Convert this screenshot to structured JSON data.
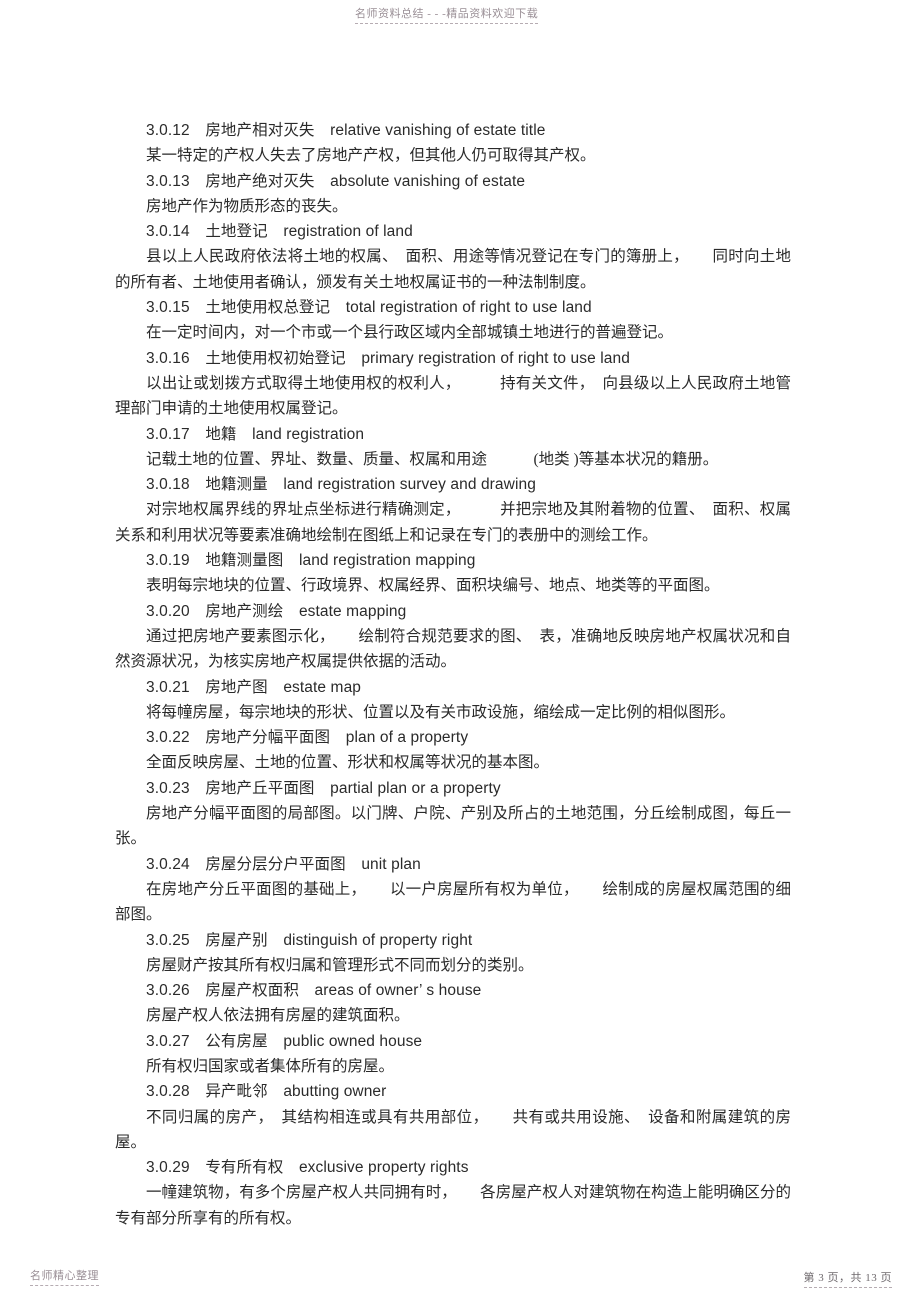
{
  "watermarks": {
    "top": "名师资料总结 - - -精品资料欢迎下载",
    "bottom_left": "名师精心整理",
    "page_footer": "第 3 页，共 13 页"
  },
  "entries": [
    {
      "number": "3.0.12",
      "term_cn": "房地产相对灭失",
      "term_en": "relative vanishing of estate title",
      "definition": "某一特定的产权人失去了房地产产权，但其他人仍可取得其产权。"
    },
    {
      "number": "3.0.13",
      "term_cn": "房地产绝对灭失",
      "term_en": "absolute vanishing of estate",
      "definition": "房地产作为物质形态的丧失。"
    },
    {
      "number": "3.0.14",
      "term_cn": "土地登记",
      "term_en": "registration of land",
      "definition": "县以上人民政府依法将土地的权属、　面积、用途等情况登记在专门的簿册上，　　同时向土地的所有者、土地使用者确认，颁发有关土地权属证书的一种法制制度。"
    },
    {
      "number": "3.0.15",
      "term_cn": "土地使用权总登记",
      "term_en": "total registration of right to use land",
      "definition": "在一定时间内，对一个市或一个县行政区域内全部城镇土地进行的普遍登记。"
    },
    {
      "number": "3.0.16",
      "term_cn": "土地使用权初始登记",
      "term_en": "primary registration of right to use land",
      "definition": "以出让或划拨方式取得土地使用权的权利人，　　　持有关文件，　向县级以上人民政府土地管理部门申请的土地使用权属登记。"
    },
    {
      "number": "3.0.17",
      "term_cn": "地籍",
      "term_en": "land registration",
      "definition": "记载土地的位置、界址、数量、质量、权属和用途　　　(地类 )等基本状况的籍册。"
    },
    {
      "number": "3.0.18",
      "term_cn": "地籍测量",
      "term_en": "land registration survey and drawing",
      "definition": "对宗地权属界线的界址点坐标进行精确测定，　　　并把宗地及其附着物的位置、　面积、权属关系和利用状况等要素准确地绘制在图纸上和记录在专门的表册中的测绘工作。"
    },
    {
      "number": "3.0.19",
      "term_cn": "地籍测量图",
      "term_en": "land registration mapping",
      "definition": "表明每宗地块的位置、行政境界、权属经界、面积块编号、地点、地类等的平面图。"
    },
    {
      "number": "3.0.20",
      "term_cn": "房地产测绘",
      "term_en": "estate mapping",
      "definition": "通过把房地产要素图示化，　　绘制符合规范要求的图、　表，准确地反映房地产权属状况和自然资源状况，为核实房地产权属提供依据的活动。"
    },
    {
      "number": "3.0.21",
      "term_cn": "房地产图",
      "term_en": "estate map",
      "definition": "将每幢房屋，每宗地块的形状、位置以及有关市政设施，缩绘成一定比例的相似图形。"
    },
    {
      "number": "3.0.22",
      "term_cn": "房地产分幅平面图",
      "term_en": "plan of a property",
      "definition": "全面反映房屋、土地的位置、形状和权属等状况的基本图。"
    },
    {
      "number": "3.0.23",
      "term_cn": "房地产丘平面图",
      "term_en": "partial plan or a property",
      "definition": "房地产分幅平面图的局部图。以门牌、户院、产别及所占的土地范围，分丘绘制成图，每丘一张。"
    },
    {
      "number": "3.0.24",
      "term_cn": "房屋分层分户平面图",
      "term_en": "unit plan",
      "definition": "在房地产分丘平面图的基础上，　　以一户房屋所有权为单位，　　绘制成的房屋权属范围的细部图。"
    },
    {
      "number": "3.0.25",
      "term_cn": "房屋产别",
      "term_en": "distinguish of property right",
      "definition": "房屋财产按其所有权归属和管理形式不同而划分的类别。"
    },
    {
      "number": "3.0.26",
      "term_cn": "房屋产权面积",
      "term_en": "areas of owner’ s house",
      "definition": "房屋产权人依法拥有房屋的建筑面积。"
    },
    {
      "number": "3.0.27",
      "term_cn": "公有房屋",
      "term_en": "public owned house",
      "definition": "所有权归国家或者集体所有的房屋。"
    },
    {
      "number": "3.0.28",
      "term_cn": "异产毗邻",
      "term_en": "abutting owner",
      "definition": "不同归属的房产，　其结构相连或具有共用部位，　　共有或共用设施、　设备和附属建筑的房屋。"
    },
    {
      "number": "3.0.29",
      "term_cn": "专有所有权",
      "term_en": "exclusive property rights",
      "definition": "一幢建筑物，有多个房屋产权人共同拥有时，　　各房屋产权人对建筑物在构造上能明确区分的专有部分所享有的所有权。"
    }
  ]
}
